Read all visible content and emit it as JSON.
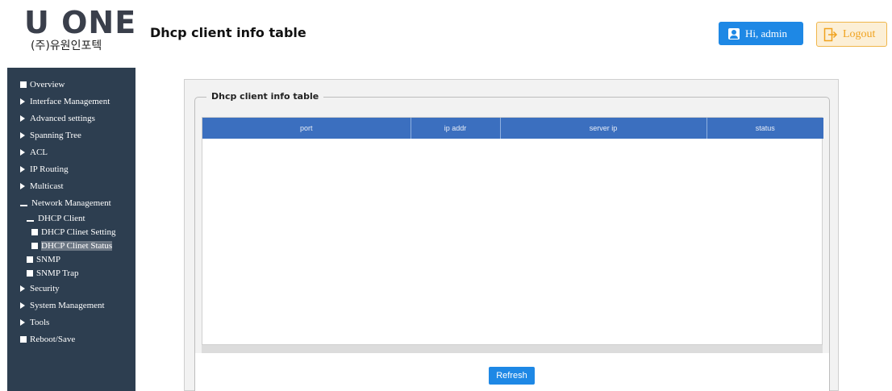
{
  "brand": {
    "logo_text": "U ONE",
    "company": "(주)유원인포텍"
  },
  "header": {
    "title": "Dhcp client info table",
    "user_label": "Hi, admin",
    "logout_label": "Logout"
  },
  "sidebar": {
    "items": [
      {
        "label": "Overview",
        "bullet": "square"
      },
      {
        "label": "Interface Management",
        "bullet": "triangle"
      },
      {
        "label": "Advanced settings",
        "bullet": "triangle"
      },
      {
        "label": "Spanning Tree",
        "bullet": "triangle"
      },
      {
        "label": "ACL",
        "bullet": "triangle"
      },
      {
        "label": "IP Routing",
        "bullet": "triangle"
      },
      {
        "label": "Multicast",
        "bullet": "triangle"
      },
      {
        "label": "Network Management",
        "bullet": "dash"
      },
      {
        "label": "DHCP Client",
        "bullet": "dash"
      },
      {
        "label": "DHCP Clinet Setting",
        "bullet": "square"
      },
      {
        "label": "DHCP Clinet Status",
        "bullet": "square"
      },
      {
        "label": "SNMP",
        "bullet": "square"
      },
      {
        "label": "SNMP Trap",
        "bullet": "square"
      },
      {
        "label": "Security",
        "bullet": "triangle"
      },
      {
        "label": "System Management",
        "bullet": "triangle"
      },
      {
        "label": "Tools",
        "bullet": "triangle"
      },
      {
        "label": "Reboot/Save",
        "bullet": "square"
      }
    ]
  },
  "panel": {
    "legend": "Dhcp client info table",
    "columns": [
      "port",
      "ip addr",
      "server ip",
      "status"
    ],
    "refresh_label": "Refresh"
  },
  "colors": {
    "accent": "#1e88e5",
    "sidebar_bg": "#2d3e50",
    "table_header": "#3b6fbf",
    "logout_bg": "#fcefd6",
    "logout_text": "#f0a21e"
  }
}
